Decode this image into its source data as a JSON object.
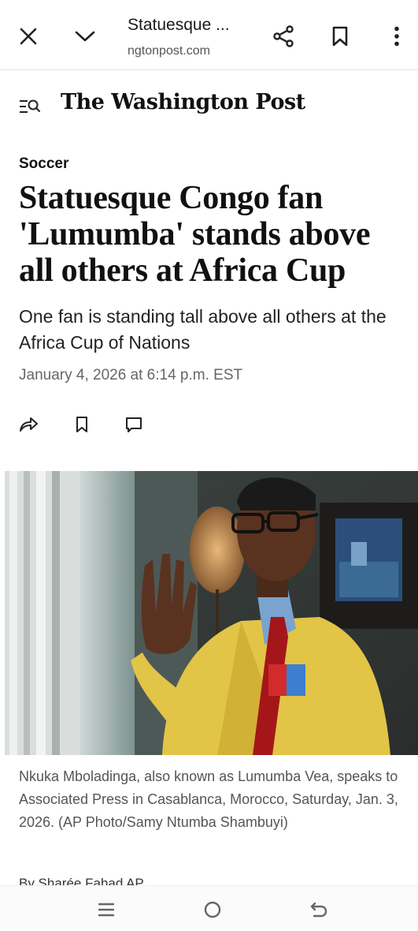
{
  "browser": {
    "title": "Statuesque ...",
    "url": "ngtonpost.com",
    "close_icon": "close-icon",
    "collapse_icon": "chevron-down-icon",
    "share_icon": "share-icon",
    "bookmark_icon": "bookmark-icon",
    "more_icon": "more-vertical-icon"
  },
  "site": {
    "menu_icon": "menu-search-icon",
    "logo": "The Washington Post"
  },
  "article": {
    "kicker": "Soccer",
    "headline": "Statuesque Congo fan 'Lumumba' stands above all others at Africa Cup",
    "dek": "One fan is standing tall above all others at the Africa Cup of Nations",
    "date": "January 4, 2026 at 6:14 p.m. EST",
    "actions": [
      "share-icon",
      "bookmark-icon",
      "comment-icon"
    ],
    "caption": "Nkuka Mboladinga, also known as Lumumba Vea, speaks to Associated Press in Casablanca, Morocco, Saturday, Jan. 3, 2026. (AP Photo/Samy Ntumba Shambuyi)",
    "byline_partial": "By Sharée Fahad AP"
  },
  "system_nav": {
    "recents_icon": "recents-icon",
    "home_icon": "home-icon",
    "back_icon": "back-icon"
  },
  "colors": {
    "jacket": "#e2c447",
    "tie": "#a4161a",
    "text_muted": "#666666"
  }
}
